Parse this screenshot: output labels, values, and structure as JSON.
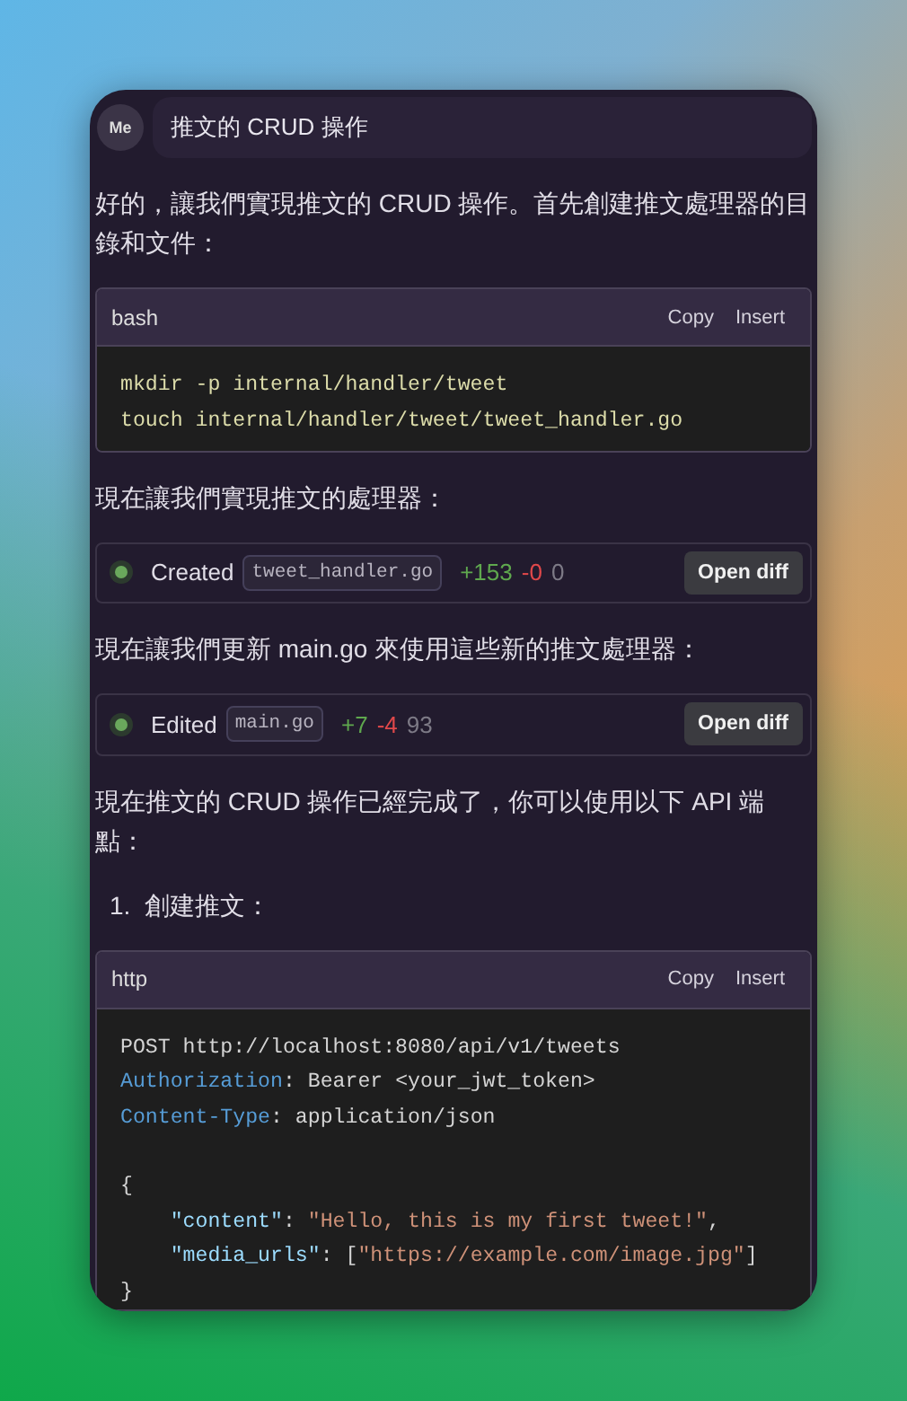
{
  "header": {
    "avatar": "Me",
    "title": "推文的 CRUD 操作"
  },
  "blocks": [
    {
      "kind": "paragraph",
      "text": "好的，讓我們實現推文的 CRUD 操作。首先創建推文處理器的目錄和文件："
    },
    {
      "kind": "code",
      "language": "bash",
      "copy": "Copy",
      "insert": "Insert",
      "groups": [
        [
          [
            {
              "text": "mkdir -p internal/handler/tweet",
              "kind": "command"
            }
          ],
          [
            {
              "text": "touch internal/handler/tweet/tweet_handler.go",
              "kind": "command"
            }
          ]
        ]
      ]
    },
    {
      "kind": "paragraph",
      "text": "現在讓我們實現推文的處理器："
    },
    {
      "kind": "change",
      "action": "Created",
      "file": "tweet_handler.go",
      "added": "+153",
      "removed": "-0",
      "total": "0",
      "button": "Open diff"
    },
    {
      "kind": "paragraph",
      "text": "現在讓我們更新 main.go 來使用這些新的推文處理器："
    },
    {
      "kind": "change",
      "action": "Edited",
      "file": "main.go",
      "added": "+7",
      "removed": "-4",
      "total": "93",
      "button": "Open diff"
    },
    {
      "kind": "paragraph",
      "text": "現在推文的 CRUD 操作已經完成了，你可以使用以下 API 端點："
    },
    {
      "kind": "list_item",
      "number": "1.",
      "text": "創建推文："
    },
    {
      "kind": "code",
      "language": "http",
      "copy": "Copy",
      "insert": "Insert",
      "groups": [
        [
          [
            {
              "text": "POST http://localhost:8080/api/v1/tweets",
              "kind": "plain"
            }
          ],
          [
            {
              "text": "Authorization",
              "kind": "key"
            },
            {
              "text": ": Bearer <your_jwt_token>",
              "kind": "plain"
            }
          ],
          [
            {
              "text": "Content-Type",
              "kind": "key"
            },
            {
              "text": ": application/json",
              "kind": "plain"
            }
          ]
        ],
        [
          [
            {
              "text": "{",
              "kind": "plain"
            }
          ],
          [
            {
              "text": "    \"content\"",
              "kind": "prop"
            },
            {
              "text": ": ",
              "kind": "plain"
            },
            {
              "text": "\"Hello, this is my first tweet!\"",
              "kind": "string"
            },
            {
              "text": ",",
              "kind": "plain"
            }
          ],
          [
            {
              "text": "    \"media_urls\"",
              "kind": "prop"
            },
            {
              "text": ": [",
              "kind": "plain"
            },
            {
              "text": "\"https://example.com/image.jpg\"",
              "kind": "string"
            },
            {
              "text": "]",
              "kind": "plain"
            }
          ],
          [
            {
              "text": "}",
              "kind": "plain"
            }
          ]
        ]
      ]
    }
  ]
}
